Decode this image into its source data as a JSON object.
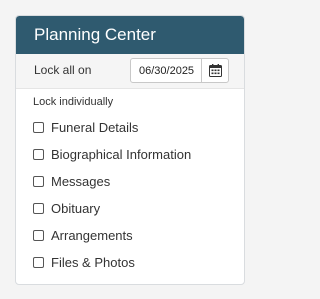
{
  "panel": {
    "title": "Planning Center",
    "header_color": "#2f5a6f"
  },
  "lock_all": {
    "label": "Lock all on",
    "date_value": "06/30/2025",
    "calendar_icon": "calendar-icon"
  },
  "lock_individually": {
    "label": "Lock individually",
    "items": [
      {
        "label": "Funeral Details",
        "checked": false
      },
      {
        "label": "Biographical Information",
        "checked": false
      },
      {
        "label": "Messages",
        "checked": false
      },
      {
        "label": "Obituary",
        "checked": false
      },
      {
        "label": "Arrangements",
        "checked": false
      },
      {
        "label": "Files & Photos",
        "checked": false
      }
    ]
  }
}
